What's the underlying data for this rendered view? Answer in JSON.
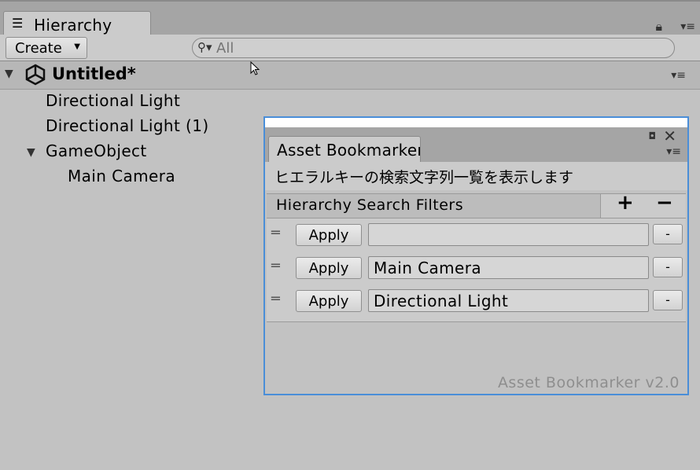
{
  "hierarchy_tab": {
    "label": "Hierarchy",
    "icon": "list-icon"
  },
  "toolbar": {
    "create_label": "Create",
    "search_placeholder": "All"
  },
  "scene": {
    "name": "Untitled*"
  },
  "items": [
    {
      "label": "Directional Light"
    },
    {
      "label": "Directional Light (1)"
    },
    {
      "label": "GameObject"
    },
    {
      "label": "Main Camera"
    }
  ],
  "bookmarker": {
    "tab_label": "Asset Bookmarker",
    "description": "ヒエラルキーの検索文字列一覧を表示します",
    "filters_title": "Hierarchy Search Filters",
    "add_label": "+",
    "remove_label": "−",
    "rows": [
      {
        "apply_label": "Apply",
        "value": "",
        "minus_label": "-"
      },
      {
        "apply_label": "Apply",
        "value": "Main Camera",
        "minus_label": "-"
      },
      {
        "apply_label": "Apply",
        "value": "Directional Light",
        "minus_label": "-"
      }
    ],
    "version": "Asset Bookmarker v2.0"
  },
  "colors": {
    "window_border": "#4a8ed8",
    "panel_bg": "#c2c2c2"
  }
}
